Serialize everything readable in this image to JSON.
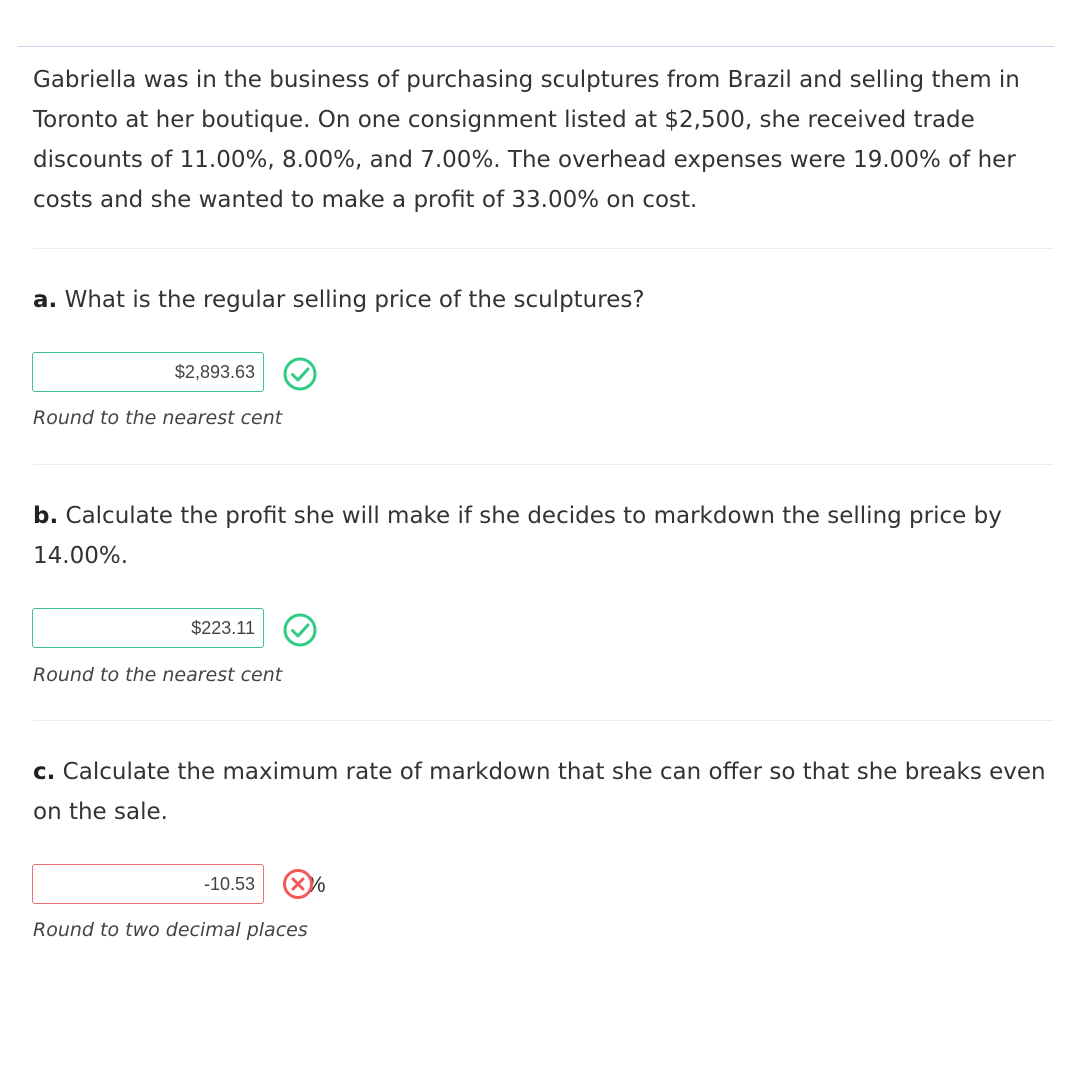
{
  "problem": {
    "intro": "Gabriella was in the business of purchasing sculptures from Brazil and selling them in Toronto at her boutique. On one consignment listed at $2,500, she received trade discounts of 11.00%, 8.00%, and 7.00%. The overhead expenses were 19.00% of her costs and she wanted to make a profit of 33.00% on cost."
  },
  "questions": [
    {
      "label": "a.",
      "text": " What is the regular selling price of the sculptures?",
      "answer": "$2,893.63",
      "status": "correct",
      "status_icon": "check-circle-icon",
      "unit": "",
      "hint": "Round to the nearest cent"
    },
    {
      "label": "b.",
      "text": " Calculate the profit she will make if she decides to markdown the selling price by 14.00%.",
      "answer": "$223.11",
      "status": "correct",
      "status_icon": "check-circle-icon",
      "unit": "",
      "hint": "Round to the nearest cent"
    },
    {
      "label": "c.",
      "text": " Calculate the maximum rate of markdown that she can offer so that she breaks even on the sale.",
      "answer": "-10.53",
      "status": "incorrect",
      "status_icon": "x-circle-icon",
      "unit": "%",
      "hint": "Round to two decimal places"
    }
  ],
  "colors": {
    "correct": "#2ecc85",
    "incorrect": "#f05a5a",
    "divider": "#ececec",
    "top_rule": "#c9d6e8"
  }
}
